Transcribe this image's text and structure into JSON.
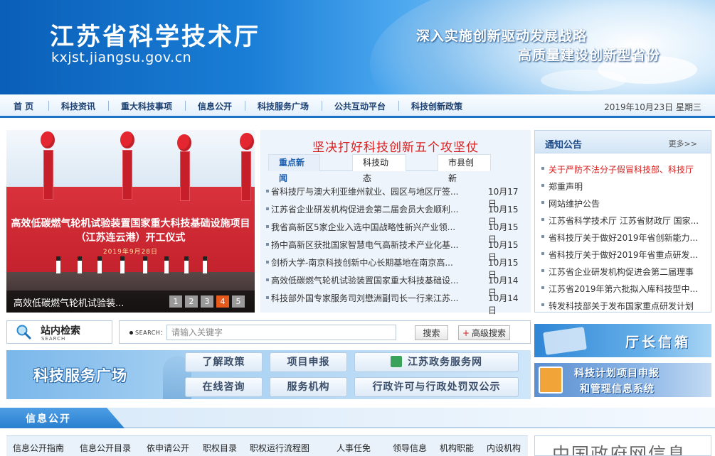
{
  "header": {
    "site_title": "江苏省科学技术厅",
    "site_url": "kxjst.jiangsu.gov.cn",
    "slogan_line1": "深入实施创新驱动发展战略",
    "slogan_line2": "高质量建设创新型省份"
  },
  "nav": {
    "items": [
      "首 页",
      "科技资讯",
      "重大科技事项",
      "信息公开",
      "科技服务广场",
      "公共互动平台",
      "科技创新政策"
    ],
    "date": "2019年10月23日 星期三"
  },
  "slider": {
    "headline": "高效低碳燃气轮机试验装置国家重大科技基础设施项目（江苏连云港）开工仪式",
    "subline": "2019年9月28日",
    "caption": "高效低碳燃气轮机试验装...",
    "pages": [
      "1",
      "2",
      "3",
      "4",
      "5"
    ],
    "active_page": 3
  },
  "news": {
    "headline": "坚决打好科技创新五个攻坚仗",
    "tabs": [
      "重点新闻",
      "科技动态",
      "市县创新"
    ],
    "active_tab": 0,
    "items": [
      {
        "title": "省科技厅与澳大利亚维州就业、园区与地区厅签...",
        "date": "10月17日"
      },
      {
        "title": "江苏省企业研发机构促进会第二届会员大会顺利...",
        "date": "10月15日"
      },
      {
        "title": "我省高新区5家企业入选中国战略性新兴产业领...",
        "date": "10月15日"
      },
      {
        "title": "扬中高新区获批国家智慧电气高新技术产业化基...",
        "date": "10月15日"
      },
      {
        "title": "剑桥大学-南京科技创新中心长期基地在南京高...",
        "date": "10月15日"
      },
      {
        "title": "高效低碳燃气轮机试验装置国家重大科技基础设...",
        "date": "10月14日"
      },
      {
        "title": "科技部外国专家服务司刘懋洲副司长一行来江苏...",
        "date": "10月14日"
      }
    ]
  },
  "notice": {
    "title": "通知公告",
    "more": "更多>>",
    "items": [
      "关于严防不法分子假冒科技部、科技厅",
      "郑重声明",
      "网站维护公告",
      "江苏省科学技术厅 江苏省财政厅 国家...",
      "省科技厅关于做好2019年省创新能力...",
      "省科技厅关于做好2019年省重点研发...",
      "江苏省企业研发机构促进会第二届理事",
      "江苏省2019年第六批拟入库科技型中...",
      "转发科技部关于发布国家重点研发计划"
    ]
  },
  "search": {
    "label": "站内检索",
    "sub": "SEARCH",
    "tag": "SEARCH：",
    "placeholder": "请输入关键字",
    "button": "搜索",
    "advanced": "高级搜索",
    "advanced_plus": "+"
  },
  "service": {
    "title": "科技服务广场",
    "buttons": [
      "了解政策",
      "项目申报",
      "江苏政务服务网",
      "在线咨询",
      "服务机构",
      "行政许可与行政处罚双公示"
    ]
  },
  "side": {
    "director": "厅长信箱",
    "plan_line1": "科技计划项目申报",
    "plan_line2": "和管理信息系统"
  },
  "info": {
    "title": "信息公开",
    "links": [
      "信息公开指南",
      "信息公开目录",
      "依申请公开",
      "职权目录",
      "职权运行流程图",
      "人事任免",
      "领导信息",
      "机构职能",
      "内设机构"
    ],
    "gov_text": "中国政府网信息"
  },
  "colors": {
    "brand_blue": "#1c73c6",
    "accent_red": "#d81e1e",
    "active_slide": "#e85a1b"
  }
}
